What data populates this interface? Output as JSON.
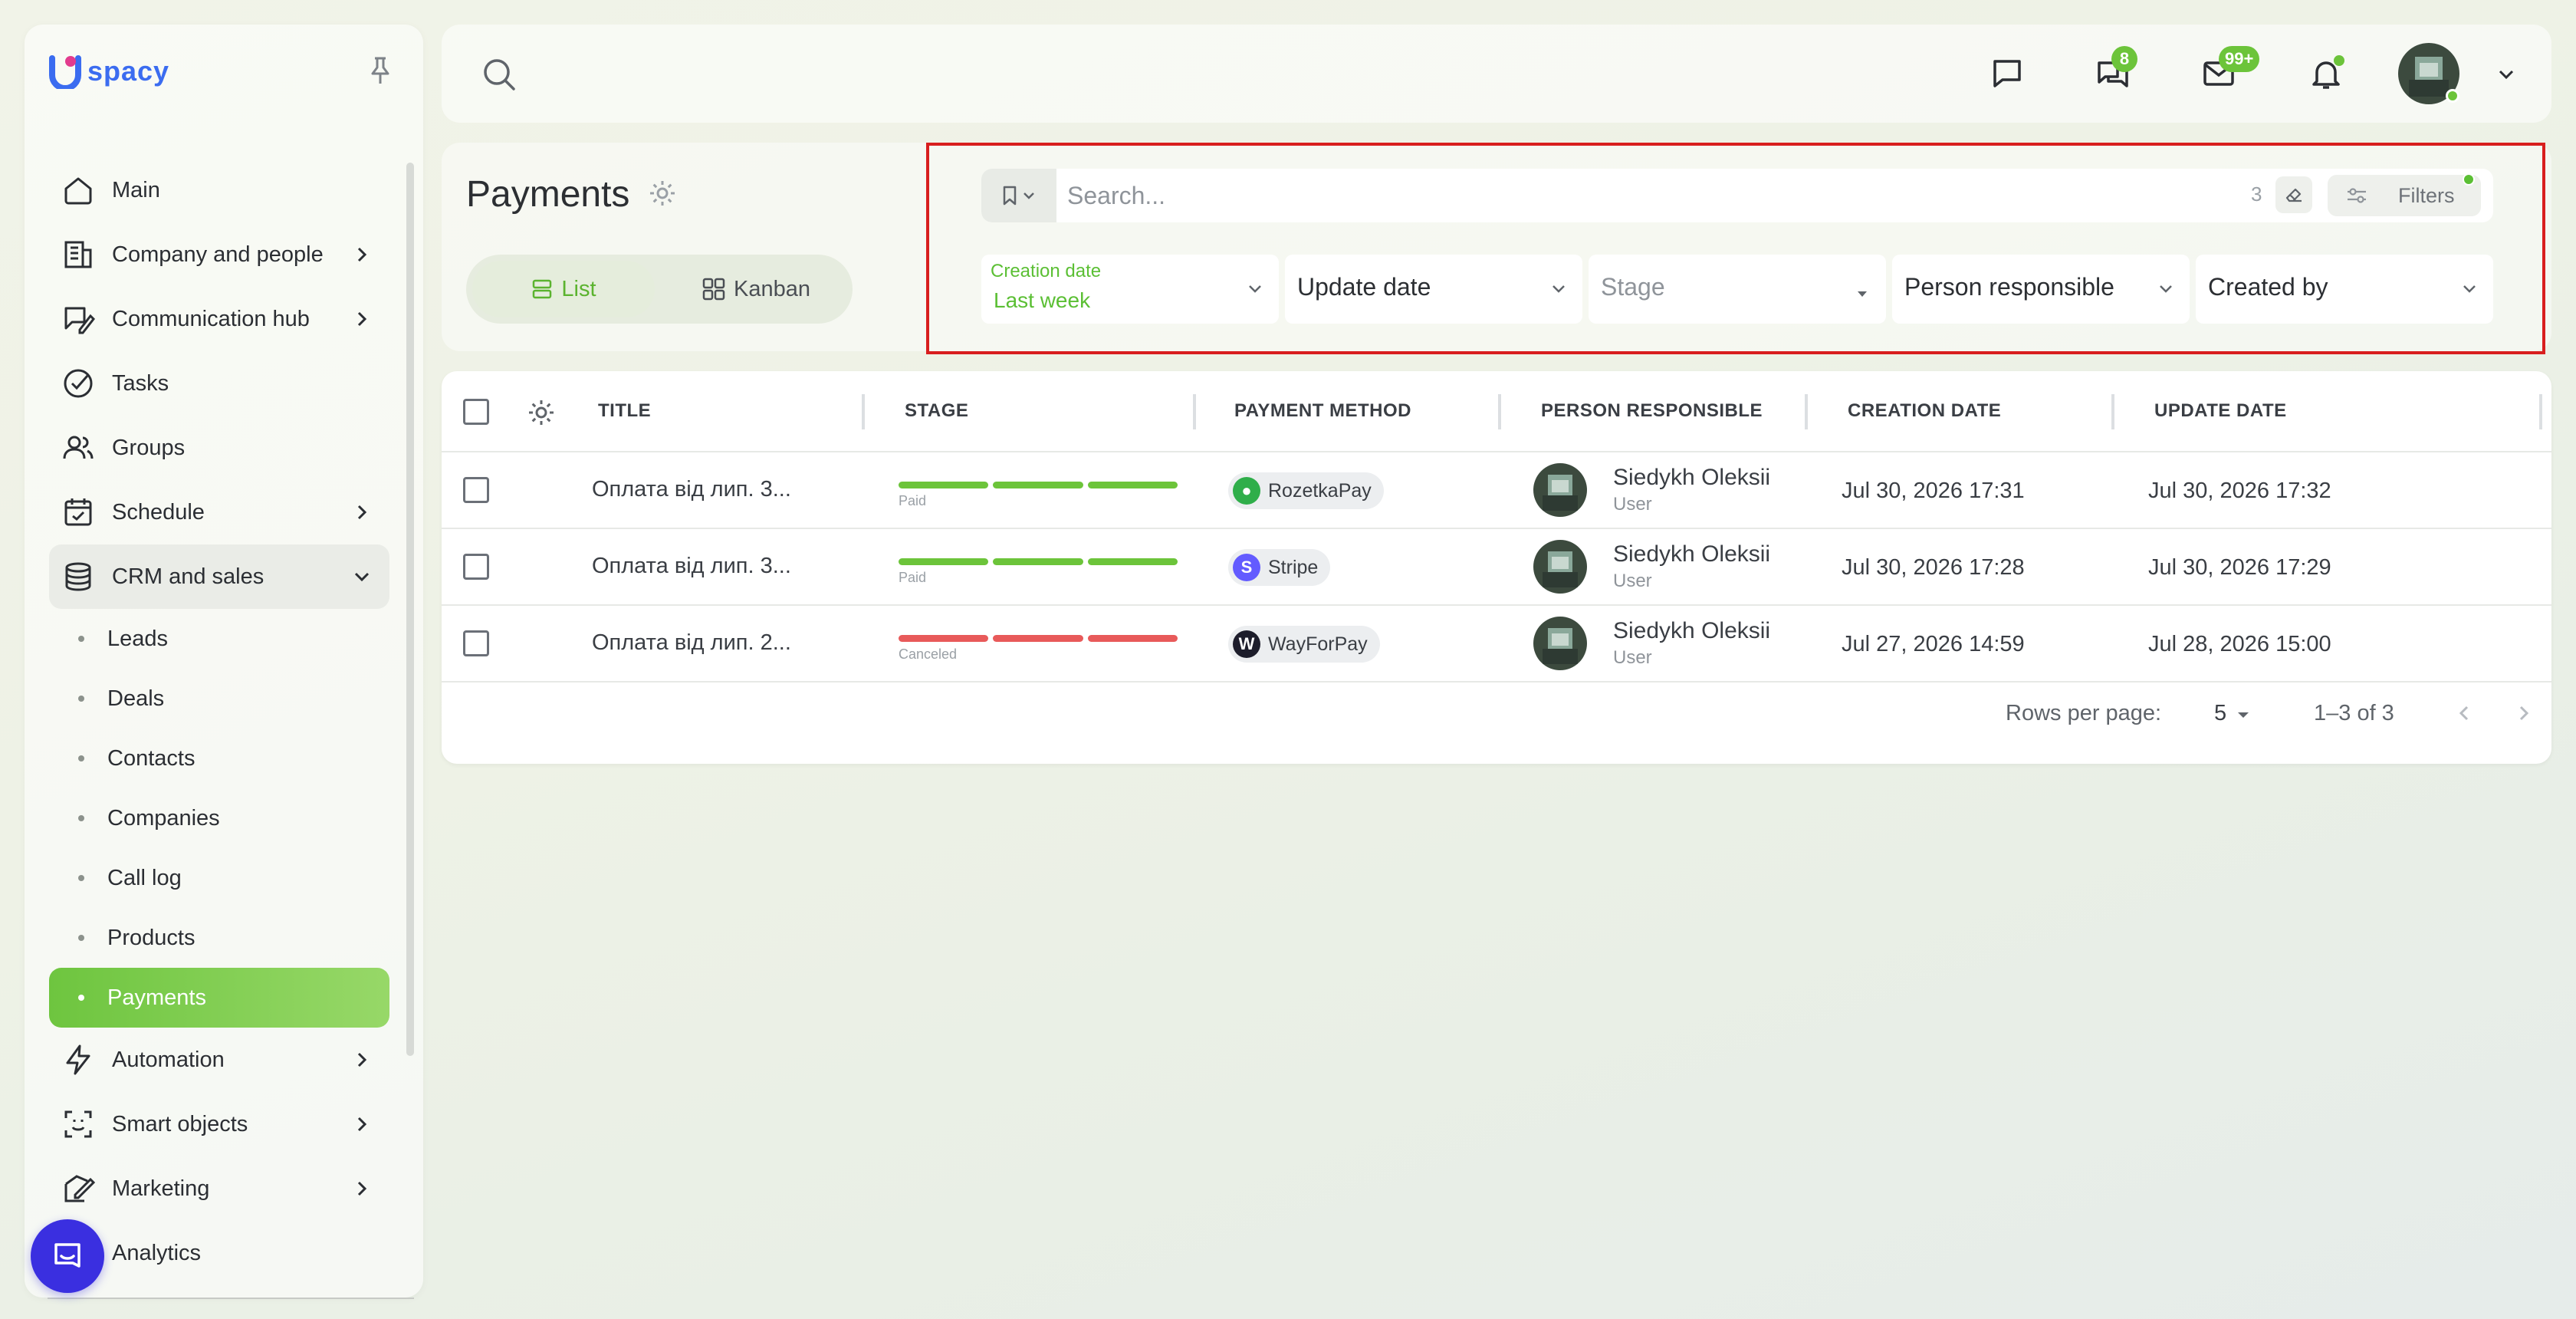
{
  "app": {
    "logo_text": "spacy"
  },
  "sidebar": {
    "items": [
      {
        "label": "Main",
        "icon": "home-icon"
      },
      {
        "label": "Company and people",
        "icon": "building-icon"
      },
      {
        "label": "Communication hub",
        "icon": "chat-edit-icon"
      },
      {
        "label": "Tasks",
        "icon": "check-circle-icon"
      },
      {
        "label": "Groups",
        "icon": "users-icon"
      },
      {
        "label": "Schedule",
        "icon": "calendar-icon"
      },
      {
        "label": "CRM and sales",
        "icon": "database-icon"
      }
    ],
    "crm_sub": [
      "Leads",
      "Deals",
      "Contacts",
      "Companies",
      "Call log",
      "Products",
      "Payments"
    ],
    "items_after": [
      {
        "label": "Automation",
        "icon": "lightning-icon"
      },
      {
        "label": "Smart objects",
        "icon": "scan-icon"
      },
      {
        "label": "Marketing",
        "icon": "marketing-icon"
      },
      {
        "label": "Analytics",
        "icon": "analytics-icon"
      }
    ]
  },
  "topbar": {
    "chat_badge": "8",
    "mail_badge": "99+"
  },
  "page": {
    "title": "Payments",
    "view_list": "List",
    "view_kanban": "Kanban"
  },
  "filters": {
    "search_placeholder": "Search...",
    "count": "3",
    "filters_label": "Filters",
    "creation_date_label": "Creation date",
    "creation_date_value": "Last week",
    "update_date": "Update date",
    "stage": "Stage",
    "person_responsible": "Person responsible",
    "created_by": "Created by"
  },
  "table": {
    "columns": [
      "TITLE",
      "STAGE",
      "PAYMENT METHOD",
      "PERSON RESPONSIBLE",
      "CREATION DATE",
      "UPDATE DATE"
    ],
    "rows": [
      {
        "title": "Оплата від лип. 3...",
        "stage": "Paid",
        "stage_color": "#6cc43a",
        "method": "RozetkaPay",
        "method_color": "#2fae4a",
        "person": "Siedykh Oleksii",
        "role": "User",
        "created": "Jul 30, 2026 17:31",
        "updated": "Jul 30, 2026 17:32"
      },
      {
        "title": "Оплата від лип. 3...",
        "stage": "Paid",
        "stage_color": "#6cc43a",
        "method": "Stripe",
        "method_color": "#635bff",
        "person": "Siedykh Oleksii",
        "role": "User",
        "created": "Jul 30, 2026 17:28",
        "updated": "Jul 30, 2026 17:29"
      },
      {
        "title": "Оплата від лип. 2...",
        "stage": "Canceled",
        "stage_color": "#e85a5a",
        "method": "WayForPay",
        "method_color": "#1d1d2b",
        "person": "Siedykh Oleksii",
        "role": "User",
        "created": "Jul 27, 2026 14:59",
        "updated": "Jul 28, 2026 15:00"
      }
    ],
    "rows_per_page_label": "Rows per page:",
    "rows_per_page": "5",
    "range": "1–3 of 3"
  },
  "colors": {
    "accent": "#6cc43a",
    "highlight_border": "#d81e1e",
    "fab": "#3a2fe0"
  }
}
